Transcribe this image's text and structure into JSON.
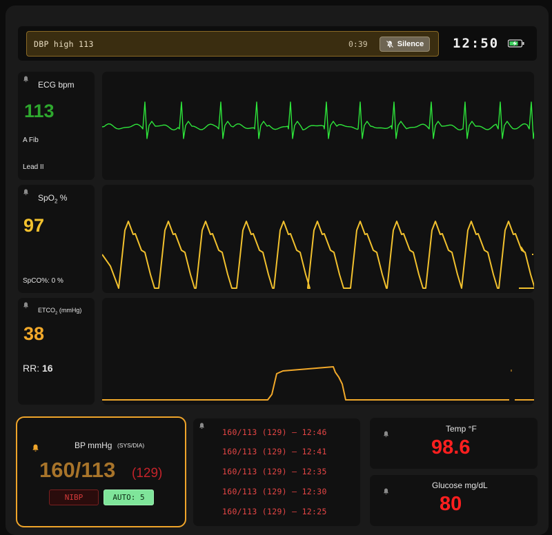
{
  "alarm": {
    "message": "DBP high 113",
    "elapsed": "0:39",
    "silence_label": "Silence"
  },
  "clock": "12:50",
  "colors": {
    "ecg": "#2ee63b",
    "spo2": "#f2c12e",
    "etco2": "#f2a92a",
    "bp_value": "#a8742a",
    "bp_mean": "#c4232a",
    "alert_red": "#ff1f1f",
    "history": "#e64545"
  },
  "ecg": {
    "label": "ECG bpm",
    "value": "113",
    "rhythm": "A Fib",
    "lead": "Lead II"
  },
  "spo2": {
    "label_main": "SpO",
    "label_sub": "2",
    "label_unit": " %",
    "value": "97",
    "spco": "SpCO%: 0 %"
  },
  "etco2": {
    "label_main": "ETCO",
    "label_sub": "2",
    "label_unit": " (mmHg)",
    "value": "38",
    "rr_label": "RR:",
    "rr_value": "16"
  },
  "bp": {
    "label": "BP mmHg",
    "label_sub": "(SYS/DIA)",
    "value": "160/113",
    "mean": "(129)",
    "nibp_label": "NIBP",
    "auto_label": "AUTO: 5"
  },
  "bp_history": [
    "160/113 (129) — 12:46",
    "160/113 (129) — 12:41",
    "160/113 (129) — 12:35",
    "160/113 (129) — 12:30",
    "160/113 (129) — 12:25"
  ],
  "temp": {
    "label": "Temp °F",
    "value": "98.6"
  },
  "glucose": {
    "label": "Glucose mg/dL",
    "value": "80"
  }
}
